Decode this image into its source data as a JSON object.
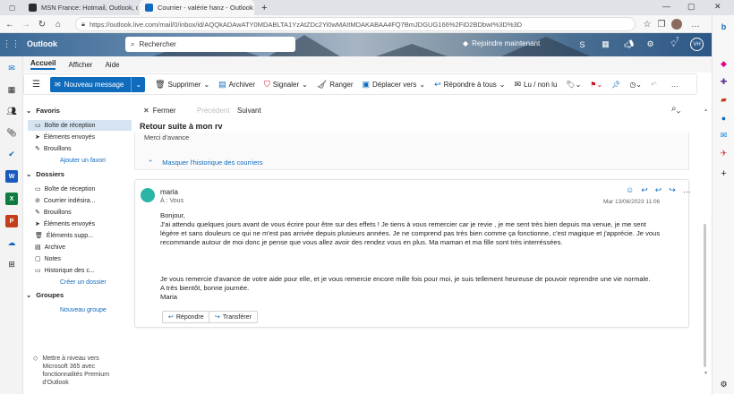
{
  "browser": {
    "tabs": [
      {
        "title": "MSN France: Hotmail, Outlook, c",
        "active": false,
        "favicon_color": "#2b2b2b"
      },
      {
        "title": "Courrier - valérie hanz - Outlook",
        "active": true,
        "favicon_color": "#0f6cbd"
      }
    ],
    "new_tab": "+",
    "url": "https://outlook.live.com/mail/0/inbox/id/AQQkADAwATY0MDABLTA1YzAtZDc2Yi0wMAItMDAKABAA4FQ7BmJDGUG166%2FiD2BDbwI%3D%3D"
  },
  "outlook": {
    "app_name": "Outlook",
    "search_placeholder": "Rechercher",
    "upgrade_label": "Rejoindre maintenant",
    "notification_count": "7",
    "avatar_initials": "VH"
  },
  "ribbon": {
    "tabs": [
      "Accueil",
      "Afficher",
      "Aide"
    ],
    "new_message": "Nouveau message",
    "commands": [
      "Supprimer",
      "Archiver",
      "Signaler",
      "Ranger",
      "Déplacer vers",
      "Répondre à tous",
      "Lu / non lu"
    ]
  },
  "folders": {
    "favorites_header": "Favoris",
    "favorites": [
      "Boîte de réception",
      "Éléments envoyés",
      "Brouillons"
    ],
    "add_favorite": "Ajouter un favori",
    "folders_header": "Dossiers",
    "folder_items": [
      "Boîte de réception",
      "Courrier indésira...",
      "Brouillons",
      "Éléments envoyés",
      "Éléments supp...",
      "Archive",
      "Notes",
      "Historique des c..."
    ],
    "create_folder": "Créer un dossier",
    "groups_header": "Groupes",
    "new_group": "Nouveau groupe",
    "upgrade_promo": "Mettre à niveau vers Microsoft 365 avec fonctionnalités Premium d'Outlook"
  },
  "reading": {
    "close_label": "Fermer",
    "previous_label": "Précédent",
    "next_label": "Suivant",
    "subject": "Retour suite à mon rv",
    "prev_snippet": "Merci d'avance",
    "history_toggle": "Masquer l'historique des courriers",
    "message": {
      "sender": "maria",
      "to_line": "À : Vous",
      "date": "Mar 13/06/2023 11:06",
      "greeting": "Bonjour,",
      "para1_line1": "J'ai attendu quelques jours avant de vous écrire pour être sur des effets ! Je tiens à vous remercier car je revie , je me sent très bien depuis ma venue, je me sent",
      "para1_line2": "légère et sans douleurs ce qui ne m'est pas arrivée depuis plusieurs années. Je ne comprend pas très bien comme ça fonctionne, c'est magique et j'apprécie. Je vous",
      "para1_line3": "recommande autour de moi donc je pense que vous allez avoir des rendez vous en plus. Ma maman et ma fille sont très interréssées.",
      "para2": "Je vous remercie d'avance de votre aide pour elle, et je vous remercie encore mille fois pour moi, je suis tellement heureuse de pouvoir reprendre une vie normale.",
      "closing": "A très bientôt, bonne journée.",
      "signature": "Maria",
      "reply_label": "Répondre",
      "forward_label": "Transférer"
    }
  },
  "colors": {
    "accent": "#0f6cbd",
    "selected_folder": "#d6e4f2",
    "avatar_bg": "#2bb5a6"
  }
}
